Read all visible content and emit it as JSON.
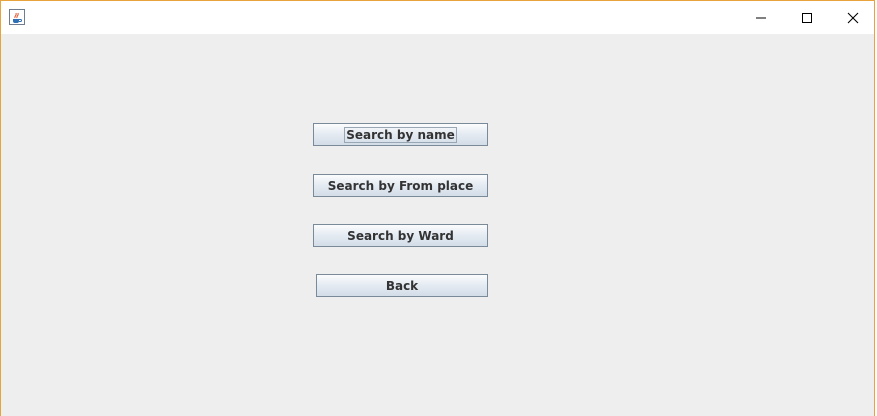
{
  "window": {
    "app_icon": "java-cup-icon",
    "controls": {
      "minimize": "minimize-icon",
      "maximize": "maximize-icon",
      "close": "close-icon"
    }
  },
  "buttons": {
    "search_by_name": "Search by name",
    "search_by_from_place": "Search by From place",
    "search_by_ward": "Search by Ward",
    "back": "Back"
  },
  "colors": {
    "window_border": "#e8a33c",
    "content_bg": "#eeeeee",
    "button_border": "#7a8a99",
    "button_text": "#333333"
  }
}
